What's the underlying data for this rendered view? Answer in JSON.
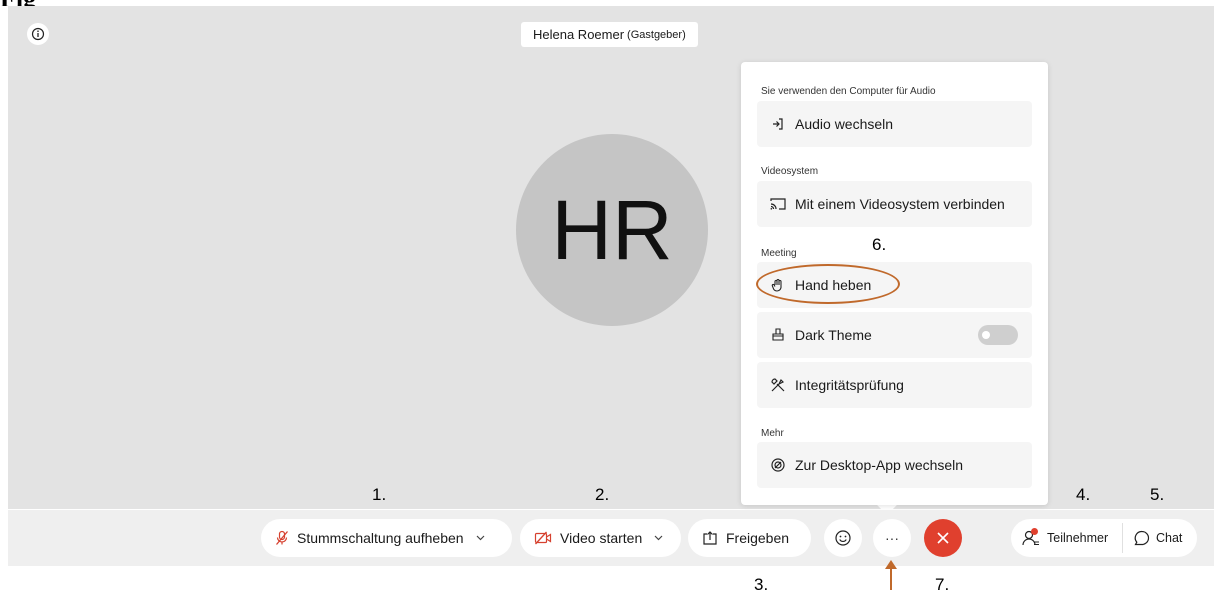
{
  "header": {
    "host_name": "Helena Roemer",
    "host_role": "(Gastgeber)"
  },
  "avatar": {
    "initials": "HR"
  },
  "menu": {
    "audio_section": "Sie verwenden den Computer für Audio",
    "audio_switch": "Audio wechseln",
    "video_section": "Videosystem",
    "video_connect": "Mit einem Videosystem verbinden",
    "meeting_section": "Meeting",
    "raise_hand": "Hand heben",
    "dark_theme": "Dark Theme",
    "dark_theme_enabled": false,
    "integrity_check": "Integritätsprüfung",
    "more_section": "Mehr",
    "desktop_app": "Zur Desktop-App wechseln"
  },
  "toolbar": {
    "unmute": "Stummschaltung aufheben",
    "start_video": "Video starten",
    "share": "Freigeben",
    "more": "···",
    "participants": "Teilnehmer",
    "chat": "Chat"
  },
  "annotations": {
    "n1": "1.",
    "n2": "2.",
    "n3": "3.",
    "n4": "4.",
    "n5": "5.",
    "n6": "6.",
    "n7": "7."
  },
  "colors": {
    "accent_annotation": "#c0692b",
    "leave_red": "#e0402e",
    "muted_red": "#d6412f"
  }
}
